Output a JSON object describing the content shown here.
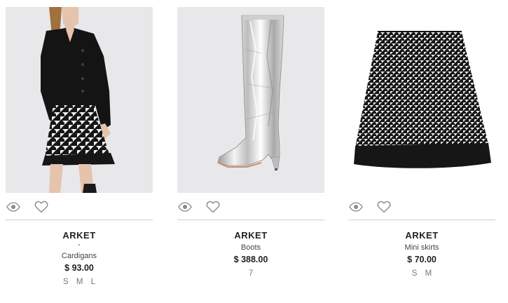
{
  "products": [
    {
      "brand": "ARKET",
      "separator": "-",
      "category": "Cardigans",
      "price": "$ 93.00",
      "sizes": "S M L",
      "image": "model-in-black-cardigan-and-houndstooth-skirt"
    },
    {
      "brand": "ARKET",
      "category": "Boots",
      "price": "$ 388.00",
      "sizes": "7",
      "image": "silver-metallic-knee-high-boot"
    },
    {
      "brand": "ARKET",
      "category": "Mini skirts",
      "price": "$ 70.00",
      "sizes": "S M",
      "image": "houndstooth-a-line-mini-skirt"
    }
  ],
  "icons": {
    "quick_view": "eye-icon",
    "wishlist": "heart-icon"
  },
  "colors": {
    "image_background": "#e8e8ea",
    "divider": "#cfcfcf",
    "icon": "#8a8a8a"
  }
}
